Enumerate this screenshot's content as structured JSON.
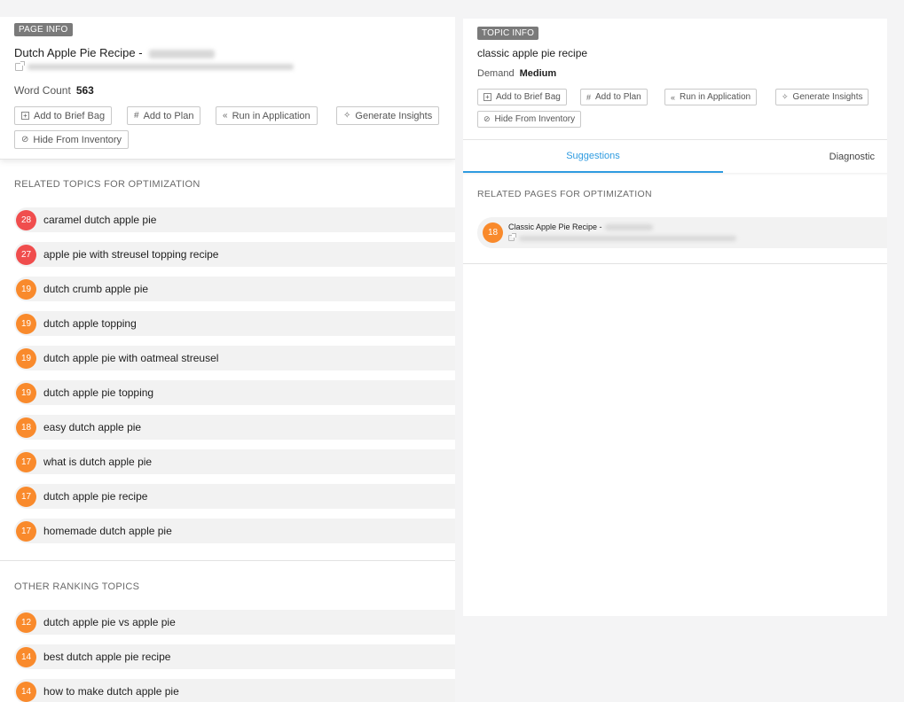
{
  "page_info": {
    "badge": "PAGE INFO",
    "title_prefix": "Dutch Apple Pie Recipe -",
    "word_count_label": "Word Count",
    "word_count_value": "563",
    "buttons": {
      "add_brief": "Add to Brief Bag",
      "add_plan": "Add to Plan",
      "run_app": "Run in Application",
      "insights": "Generate Insights",
      "hide": "Hide From Inventory"
    }
  },
  "related_topics": {
    "heading": "RELATED TOPICS FOR OPTIMIZATION",
    "items": [
      {
        "score": "28",
        "label": "caramel dutch apple pie",
        "color": "#f04d4d"
      },
      {
        "score": "27",
        "label": "apple pie with streusel topping recipe",
        "color": "#f04d4d"
      },
      {
        "score": "19",
        "label": "dutch crumb apple pie",
        "color": "#f98a2c"
      },
      {
        "score": "19",
        "label": "dutch apple topping",
        "color": "#f98a2c"
      },
      {
        "score": "19",
        "label": "dutch apple pie with oatmeal streusel",
        "color": "#f98a2c"
      },
      {
        "score": "19",
        "label": "dutch apple pie topping",
        "color": "#f98a2c"
      },
      {
        "score": "18",
        "label": "easy dutch apple pie",
        "color": "#f98a2c"
      },
      {
        "score": "17",
        "label": "what is dutch apple pie",
        "color": "#f98a2c"
      },
      {
        "score": "17",
        "label": "dutch apple pie recipe",
        "color": "#f98a2c"
      },
      {
        "score": "17",
        "label": "homemade dutch apple pie",
        "color": "#f98a2c"
      }
    ]
  },
  "other_topics": {
    "heading": "OTHER RANKING TOPICS",
    "items": [
      {
        "score": "12",
        "label": "dutch apple pie vs apple pie",
        "color": "#f98a2c"
      },
      {
        "score": "14",
        "label": "best dutch apple pie recipe",
        "color": "#f98a2c"
      },
      {
        "score": "14",
        "label": "how to make dutch apple pie",
        "color": "#f98a2c"
      }
    ]
  },
  "topic_info": {
    "badge": "TOPIC INFO",
    "title": "classic apple pie recipe",
    "demand_label": "Demand",
    "demand_value": "Medium",
    "buttons": {
      "add_brief": "Add to Brief Bag",
      "add_plan": "Add to Plan",
      "run_app": "Run in Application",
      "insights": "Generate Insights",
      "hide": "Hide From Inventory"
    }
  },
  "tabs": {
    "suggestions": "Suggestions",
    "diagnostic": "Diagnostic"
  },
  "related_pages": {
    "heading": "RELATED PAGES FOR OPTIMIZATION",
    "items": [
      {
        "score": "18",
        "title_prefix": "Classic Apple Pie Recipe -",
        "color": "#f98a2c"
      }
    ]
  }
}
